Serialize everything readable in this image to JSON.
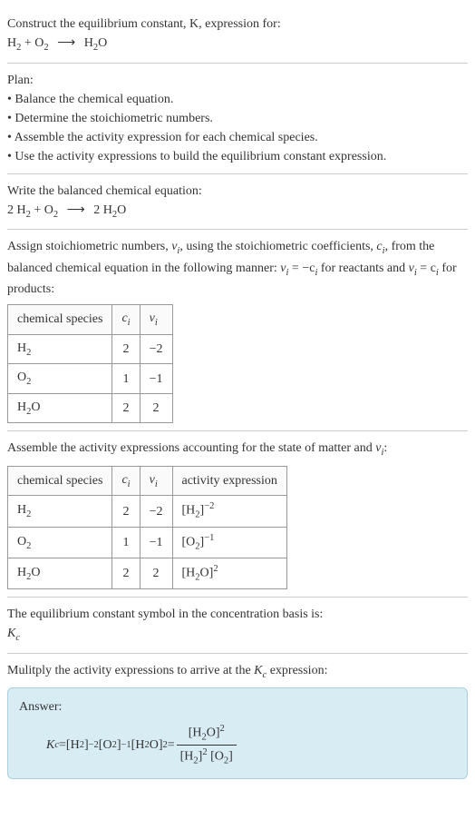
{
  "prompt": {
    "line1": "Construct the equilibrium constant, K, expression for:",
    "equation_lhs1": "H",
    "equation_sub1": "2",
    "equation_plus": " + O",
    "equation_sub2": "2",
    "equation_arrow": "⟶",
    "equation_rhs": "H",
    "equation_sub3": "2",
    "equation_rhs2": "O"
  },
  "plan": {
    "heading": "Plan:",
    "items": [
      "Balance the chemical equation.",
      "Determine the stoichiometric numbers.",
      "Assemble the activity expression for each chemical species.",
      "Use the activity expressions to build the equilibrium constant expression."
    ]
  },
  "balanced": {
    "heading": "Write the balanced chemical equation:",
    "c1": "2 H",
    "s1": "2",
    "plus": " + O",
    "s2": "2",
    "arrow": "⟶",
    "c2": "2 H",
    "s3": "2",
    "c3": "O"
  },
  "stoich": {
    "heading_part1": "Assign stoichiometric numbers, ",
    "heading_nu": "ν",
    "heading_i": "i",
    "heading_part2": ", using the stoichiometric coefficients, ",
    "heading_c": "c",
    "heading_part3": ", from the balanced chemical equation in the following manner: ",
    "heading_eq1a": "ν",
    "heading_eq1b": " = −c",
    "heading_part4": " for reactants and ",
    "heading_eq2a": "ν",
    "heading_eq2b": " = c",
    "heading_part5": " for products:",
    "table": {
      "headers": {
        "species": "chemical species",
        "ci": "c",
        "ci_sub": "i",
        "nui": "ν",
        "nui_sub": "i"
      },
      "rows": [
        {
          "sp_base": "H",
          "sp_sub": "2",
          "sp_suffix": "",
          "ci": "2",
          "nui": "−2"
        },
        {
          "sp_base": "O",
          "sp_sub": "2",
          "sp_suffix": "",
          "ci": "1",
          "nui": "−1"
        },
        {
          "sp_base": "H",
          "sp_sub": "2",
          "sp_suffix": "O",
          "ci": "2",
          "nui": "2"
        }
      ]
    }
  },
  "activity": {
    "heading_part1": "Assemble the activity expressions accounting for the state of matter and ",
    "heading_nu": "ν",
    "heading_i": "i",
    "heading_part2": ":",
    "table": {
      "headers": {
        "species": "chemical species",
        "ci": "c",
        "ci_sub": "i",
        "nui": "ν",
        "nui_sub": "i",
        "activity": "activity expression"
      },
      "rows": [
        {
          "sp_base": "H",
          "sp_sub": "2",
          "sp_suffix": "",
          "ci": "2",
          "nui": "−2",
          "ae_base": "[H",
          "ae_sub": "2",
          "ae_suffix": "]",
          "ae_sup": "−2"
        },
        {
          "sp_base": "O",
          "sp_sub": "2",
          "sp_suffix": "",
          "ci": "1",
          "nui": "−1",
          "ae_base": "[O",
          "ae_sub": "2",
          "ae_suffix": "]",
          "ae_sup": "−1"
        },
        {
          "sp_base": "H",
          "sp_sub": "2",
          "sp_suffix": "O",
          "ci": "2",
          "nui": "2",
          "ae_base": "[H",
          "ae_sub": "2",
          "ae_suffix": "O]",
          "ae_sup": "2"
        }
      ]
    }
  },
  "symbol": {
    "heading": "The equilibrium constant symbol in the concentration basis is:",
    "k": "K",
    "k_sub": "c"
  },
  "multiply": {
    "heading_part1": "Mulitply the activity expressions to arrive at the ",
    "heading_k": "K",
    "heading_k_sub": "c",
    "heading_part2": " expression:"
  },
  "answer": {
    "label": "Answer:",
    "kc": "K",
    "kc_sub": "c",
    "eq": " = ",
    "t1_base": "[H",
    "t1_sub": "2",
    "t1_suffix": "]",
    "t1_sup": "−2",
    "t2_base": " [O",
    "t2_sub": "2",
    "t2_suffix": "]",
    "t2_sup": "−1",
    "t3_base": " [H",
    "t3_sub": "2",
    "t3_suffix": "O]",
    "t3_sup": "2",
    "eq2": " = ",
    "num_base": "[H",
    "num_sub": "2",
    "num_suffix": "O]",
    "num_sup": "2",
    "den1_base": "[H",
    "den1_sub": "2",
    "den1_suffix": "]",
    "den1_sup": "2",
    "den2_base": " [O",
    "den2_sub": "2",
    "den2_suffix": "]"
  },
  "chart_data": {
    "type": "table",
    "title": "Stoichiometric numbers and activity expressions for 2 H2 + O2 -> 2 H2O",
    "columns": [
      "chemical species",
      "c_i",
      "nu_i",
      "activity expression"
    ],
    "rows": [
      [
        "H2",
        2,
        -2,
        "[H2]^(-2)"
      ],
      [
        "O2",
        1,
        -1,
        "[O2]^(-1)"
      ],
      [
        "H2O",
        2,
        2,
        "[H2O]^2"
      ]
    ],
    "equilibrium_constant": "K_c = [H2O]^2 / ([H2]^2 [O2])"
  }
}
